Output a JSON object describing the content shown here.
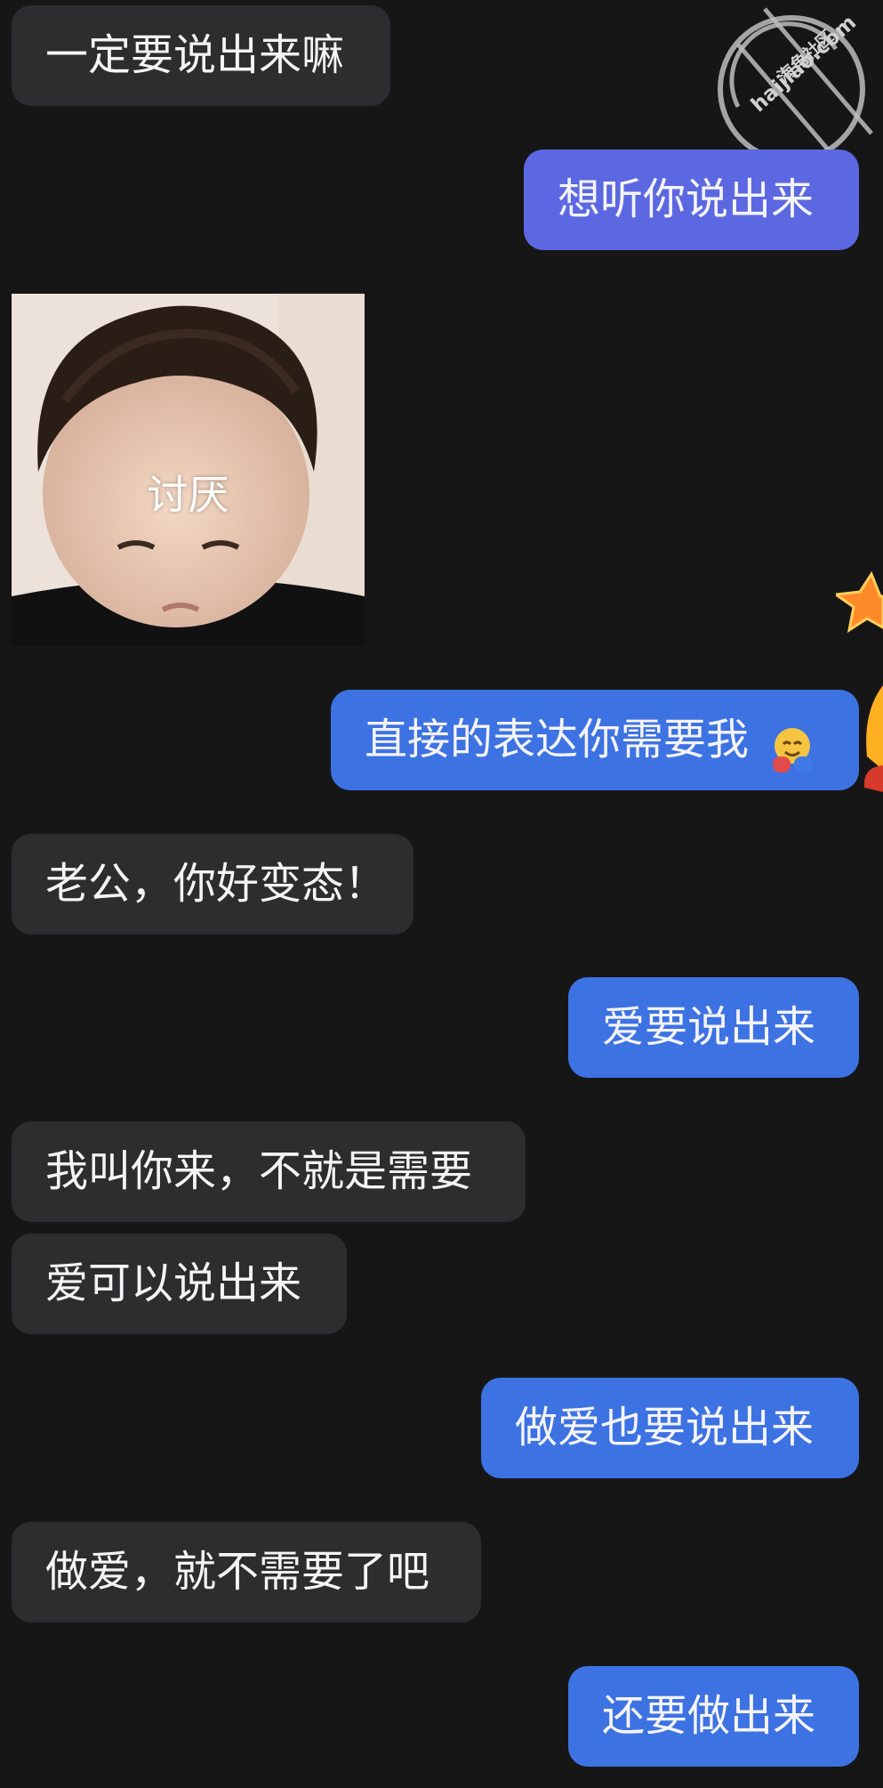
{
  "colors": {
    "background": "#161617",
    "incoming_bubble": "#2d2d30",
    "outgoing_bubble": "#3d72e3",
    "outgoing_bubble_alt": "#5c68e1",
    "text": "#f4f4f6"
  },
  "watermark": {
    "name": "海角社区",
    "domain": "haijiao.com"
  },
  "messages": [
    {
      "side": "incoming",
      "text": "一定要说出来嘛"
    },
    {
      "side": "outgoing",
      "text": "想听你说出来"
    },
    {
      "side": "incoming",
      "type": "sticker",
      "caption": "讨厌"
    },
    {
      "side": "outgoing",
      "text": "直接的表达你需要我",
      "emoji": "hugging-face-emoji"
    },
    {
      "side": "incoming",
      "text": "老公，你好变态！"
    },
    {
      "side": "outgoing",
      "text": "爱要说出来"
    },
    {
      "side": "incoming",
      "text": "我叫你来，不就是需要"
    },
    {
      "side": "incoming",
      "text": "爱可以说出来"
    },
    {
      "side": "outgoing",
      "text": "做爱也要说出来"
    },
    {
      "side": "incoming",
      "text": "做爱，就不需要了吧"
    },
    {
      "side": "outgoing",
      "text": "还要做出来"
    }
  ]
}
